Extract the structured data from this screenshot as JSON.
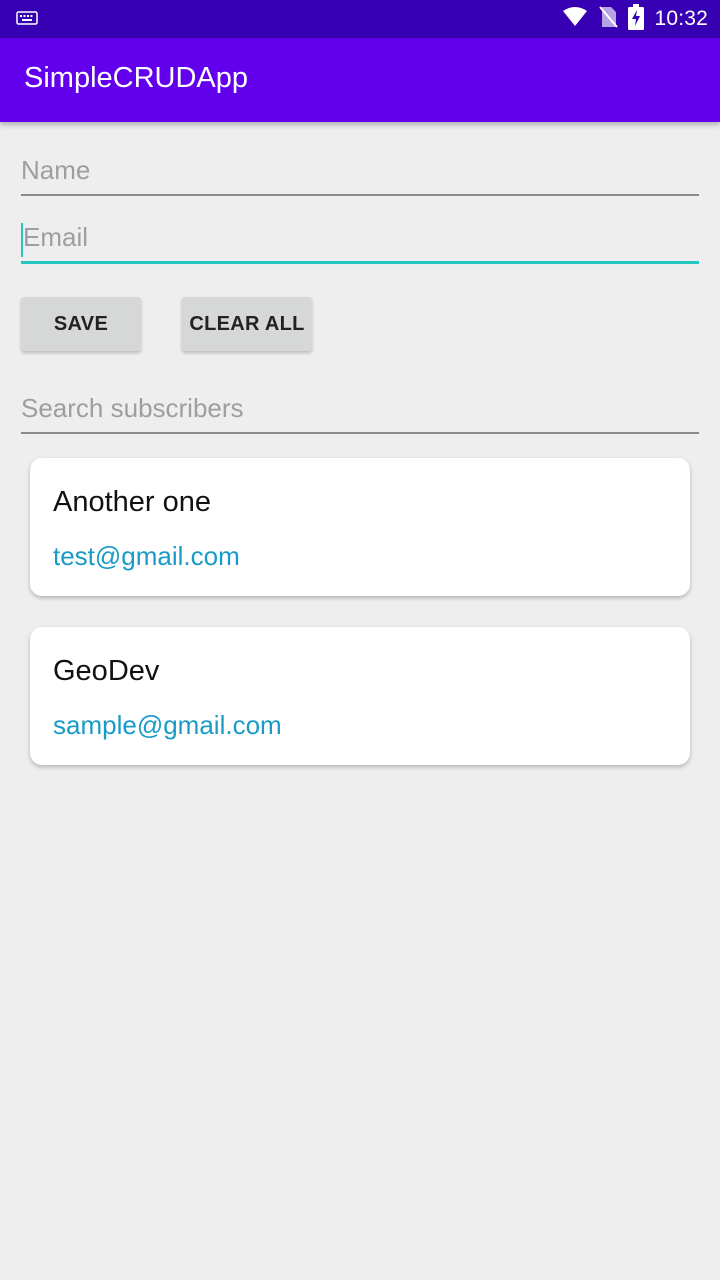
{
  "status_bar": {
    "time": "10:32",
    "icons": [
      "keyboard-icon",
      "wifi-icon",
      "no-sim-icon",
      "battery-charging-icon"
    ]
  },
  "app_bar": {
    "title": "SimpleCRUDApp"
  },
  "form": {
    "name_placeholder": "Name",
    "name_value": "",
    "email_placeholder": "Email",
    "email_value": "",
    "save_label": "SAVE",
    "clear_label": "CLEAR ALL",
    "search_placeholder": "Search subscribers",
    "search_value": ""
  },
  "subscribers": [
    {
      "name": "Another one",
      "email": "test@gmail.com"
    },
    {
      "name": "GeoDev",
      "email": "sample@gmail.com"
    }
  ],
  "colors": {
    "status_bar": "#3700b3",
    "app_bar": "#6200ee",
    "accent": "#26c6c0",
    "email_text": "#1a9bc7",
    "background": "#eeeeee"
  }
}
